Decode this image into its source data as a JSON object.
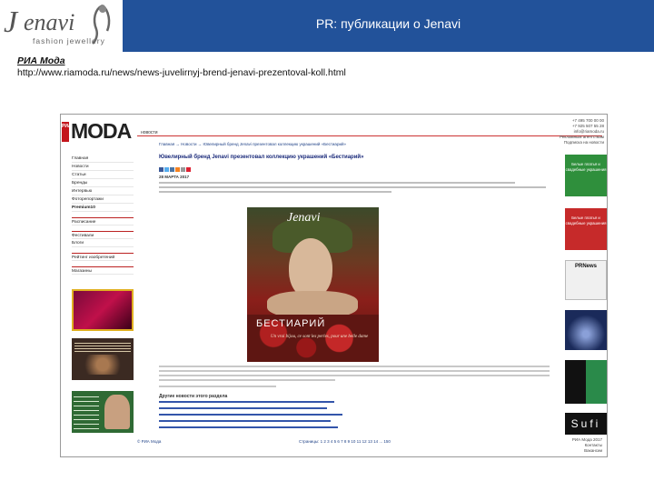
{
  "slide": {
    "title": "PR: публикации о Jenavi",
    "logo_tagline": "fashion jewellery",
    "logo_mark": "J",
    "logo_word": "enavi",
    "source_label": "РИА Мода",
    "source_url": "http://www.riamoda.ru/news/news-juvelirnyj-brend-jenavi-prezentoval-koll.html"
  },
  "site": {
    "logo": "MODA",
    "logo_prefix": "РИА",
    "tab": "новости",
    "breadcrumb": "Главная  →  Новости  →  Ювелирный бренд Jenavi презентовал коллекцию украшений «Бестиарий»",
    "contact": [
      "+7 495 700 00 00",
      "+7 925 507 55 28",
      "info@riamoda.ru",
      "Рекламным агентствам",
      "Подписка на новости"
    ],
    "nav": [
      "Главная",
      "Новости",
      "Статьи",
      "Бренды",
      "Интервью",
      "Фоторепортажи"
    ],
    "nav2": [
      "Расписание",
      "Фестивали",
      "Блоги",
      "Рейтинг изобретений",
      "Магазины"
    ],
    "nav_special": "Premium10",
    "headline": "Ювелирный бренд Jenavi презентовал коллекцию украшений «Бестиарий»",
    "date": "28 МАРТА 2017",
    "photo": {
      "brand": "Jenavi",
      "title": "БЕСТИАРИЙ",
      "subtitle": "Un vrai bijou, ce sont les perles, pour une belle dame"
    },
    "related_heading": "Другие новости этого раздела",
    "footer_left": "© РИА Мода",
    "pager": "Страницы: 1 2 3 4 5 6 7 8 9 10 11 12 13 14 ... 150",
    "footer_right": [
      "РИА Мода 2017",
      "Контакты",
      "Вакансии"
    ],
    "right_ads": [
      {
        "text": "Белые платья и свадебные украшения",
        "color": "#2f8f3c"
      },
      {
        "text": "Белые платья и свадебные украшения",
        "color": "#c62a2a"
      },
      {
        "text": "PRNews",
        "color": "#dcdcdc"
      },
      {
        "text": "",
        "color": "#1a2a5a"
      },
      {
        "text": "Sufi",
        "color": "#111111"
      }
    ]
  }
}
